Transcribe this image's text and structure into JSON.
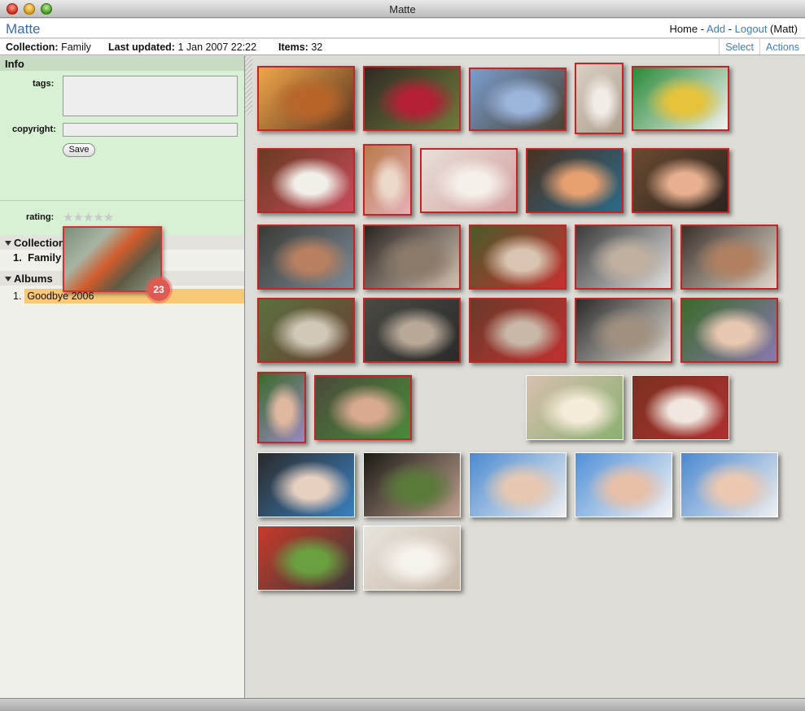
{
  "window": {
    "title": "Matte"
  },
  "header": {
    "app_name": "Matte",
    "nav": {
      "home": "Home",
      "sep1": " - ",
      "add": "Add",
      "sep2": " - ",
      "logout": "Logout",
      "user": " (Matt)"
    }
  },
  "infobar": {
    "collection_label": "Collection:",
    "collection_value": "Family",
    "updated_label": "Last updated:",
    "updated_value": "1 Jan 2007 22:22",
    "items_label": "Items:",
    "items_value": "32",
    "select_label": "Select",
    "actions_label": "Actions"
  },
  "sidebar": {
    "info_title": "Info",
    "tags_label": "tags:",
    "copyright_label": "copyright:",
    "save_label": "Save",
    "rating_label": "rating:",
    "rating_stars": "★★★★★",
    "rating_value": 0,
    "collections_title": "Collections",
    "collections": [
      {
        "num": "1.",
        "name": "Family"
      }
    ],
    "albums_title": "Albums",
    "albums": [
      {
        "num": "1.",
        "name": "Goodbye 2006"
      }
    ]
  },
  "drag": {
    "badge": "23"
  },
  "colors": {
    "accent": "#3d7cc0",
    "selected_border": "#c32424",
    "info_panel": "#d8f0d4",
    "badge": "#e05a54"
  },
  "photos": [
    {
      "selected": true,
      "tone": "baby-sleeping-warm"
    },
    {
      "selected": true,
      "tone": "red-flowers"
    },
    {
      "selected": true,
      "tone": "tree-sky"
    },
    {
      "selected": true,
      "tone": "baby-bassinet"
    },
    {
      "selected": true,
      "tone": "baby-colorful-blanket"
    },
    {
      "selected": true,
      "tone": "baby-on-bed"
    },
    {
      "selected": true,
      "tone": "baby-standing"
    },
    {
      "selected": true,
      "tone": "baby-sleeping"
    },
    {
      "selected": true,
      "tone": "woman-holding-baby"
    },
    {
      "selected": true,
      "tone": "baby-closeup"
    },
    {
      "selected": true,
      "tone": "boy-with-cup"
    },
    {
      "selected": true,
      "tone": "party-group"
    },
    {
      "selected": true,
      "tone": "women-talking"
    },
    {
      "selected": true,
      "tone": "men-talking"
    },
    {
      "selected": true,
      "tone": "two-women"
    },
    {
      "selected": true,
      "tone": "group-outdoors"
    },
    {
      "selected": true,
      "tone": "party-seated"
    },
    {
      "selected": true,
      "tone": "party-room"
    },
    {
      "selected": true,
      "tone": "people-indoors"
    },
    {
      "selected": true,
      "tone": "baby-on-grass"
    },
    {
      "selected": true,
      "tone": "baby-on-grass-2"
    },
    {
      "selected": true,
      "tone": "woman-baby-lawn"
    },
    {
      "selected": false,
      "tone": "baby-on-blanket"
    },
    {
      "selected": false,
      "tone": "baby-with-toy"
    },
    {
      "selected": false,
      "tone": "baby-laughing"
    },
    {
      "selected": false,
      "tone": "couple-garden"
    },
    {
      "selected": false,
      "tone": "baby-blue-pillow"
    },
    {
      "selected": false,
      "tone": "baby-blue-pillow-2"
    },
    {
      "selected": false,
      "tone": "baby-blue-pillow-3"
    },
    {
      "selected": false,
      "tone": "couple-hammock"
    },
    {
      "selected": false,
      "tone": "baby-in-sling"
    }
  ]
}
